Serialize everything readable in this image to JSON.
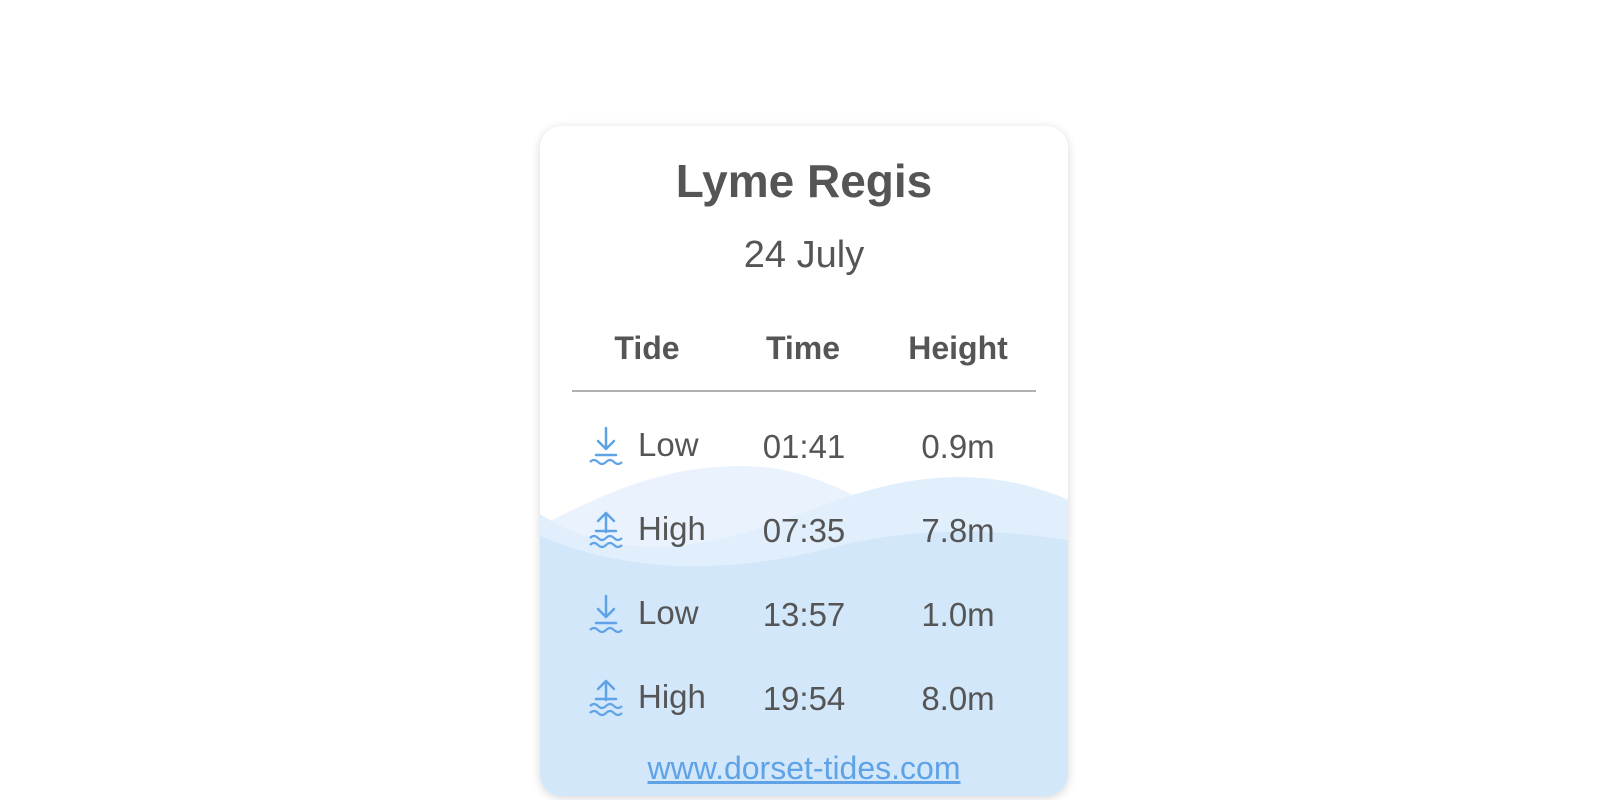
{
  "card": {
    "title": "Lyme Regis",
    "date": "24 July",
    "columns": {
      "tide": "Tide",
      "time": "Time",
      "height": "Height"
    },
    "rows": [
      {
        "tide": "Low",
        "time": "01:41",
        "height": "0.9m",
        "icon": "low-tide-icon"
      },
      {
        "tide": "High",
        "time": "07:35",
        "height": "7.8m",
        "icon": "high-tide-icon"
      },
      {
        "tide": "Low",
        "time": "13:57",
        "height": "1.0m",
        "icon": "low-tide-icon"
      },
      {
        "tide": "High",
        "time": "19:54",
        "height": "8.0m",
        "icon": "high-tide-icon"
      }
    ],
    "link": "www.dorset-tides.com"
  },
  "colors": {
    "text": "#555555",
    "accent": "#5fa3e6",
    "water": "#d3e7fb"
  }
}
